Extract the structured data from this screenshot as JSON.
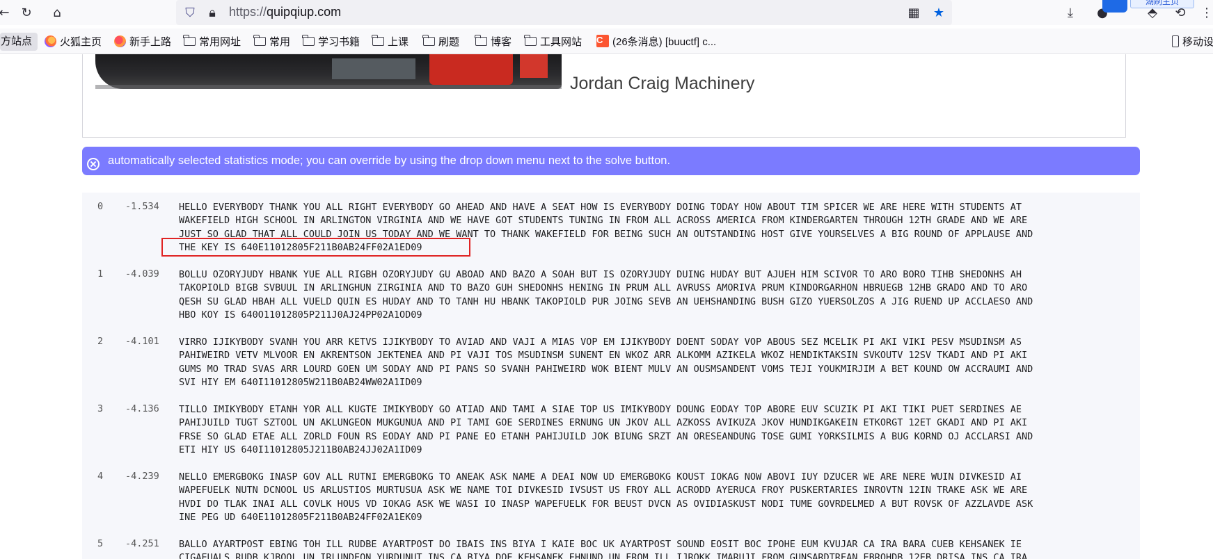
{
  "browser": {
    "url_protocol": "https://",
    "url_host": "quipqiup.com"
  },
  "tooltip": "湖刷主页",
  "bookmarks": {
    "first": "官方站点",
    "items": [
      {
        "label": "火狐主页",
        "icon": "firefox-icon"
      },
      {
        "label": "新手上路",
        "icon": "firefox-icon"
      },
      {
        "label": "常用网址",
        "icon": "folder-icon"
      },
      {
        "label": "常用",
        "icon": "folder-icon"
      },
      {
        "label": "学习书籍",
        "icon": "folder-icon"
      },
      {
        "label": "上课",
        "icon": "folder-icon"
      },
      {
        "label": "刷题",
        "icon": "folder-icon"
      },
      {
        "label": "博客",
        "icon": "folder-icon"
      },
      {
        "label": "工具网站",
        "icon": "folder-icon"
      },
      {
        "label": "(26条消息) [buuctf] c...",
        "icon": "csdn-icon"
      }
    ],
    "mobile": "移动设"
  },
  "hero": {
    "title": "Jordan Craig Machinery"
  },
  "alert": {
    "text": "automatically selected statistics mode; you can override by using the drop down menu next to the solve button."
  },
  "results": [
    {
      "index": "0",
      "score": "-1.534",
      "lines": [
        "HELLO EVERYBODY THANK YOU ALL RIGHT EVERYBODY GO AHEAD AND HAVE A SEAT HOW IS EVERYBODY DOING TODAY HOW ABOUT TIM SPICER WE ARE HERE WITH STUDENTS AT",
        "WAKEFIELD HIGH SCHOOL IN ARLINGTON VIRGINIA AND WE HAVE GOT STUDENTS TUNING IN FROM ALL ACROSS AMERICA FROM KINDERGARTEN THROUGH 12TH GRADE AND WE ARE",
        "JUST SO GLAD THAT ALL COULD JOIN US TODAY AND WE WANT TO THANK WAKEFIELD FOR BEING SUCH AN OUTSTANDING HOST GIVE YOURSELVES A BIG ROUND OF APPLAUSE AND",
        "THE KEY IS 640E11012805F211B0AB24FF02A1ED09"
      ]
    },
    {
      "index": "1",
      "score": "-4.039",
      "lines": [
        "BOLLU OZORYJUDY HBANK YUE ALL RIGBH OZORYJUDY GU ABOAD AND BAZO A SOAH BUT IS OZORYJUDY DUING HUDAY BUT AJUEH HIM SCIVOR TO ARO BORO TIHB SHEDONHS AH",
        "TAKOPIOLD BIGB SVBUUL IN ARLINGHUN ZIRGINIA AND TO BAZO GUH SHEDONHS HENING IN PRUM ALL AVRUSS AMORIVA PRUM KINDORGARHON HBRUEGB 12HB GRADO AND TO ARO",
        "QESH SU GLAD HBAH ALL VUELD QUIN ES HUDAY AND TO TANH HU HBANK TAKOPIOLD PUR JOING SEVB AN UEHSHANDING BUSH GIZO YUERSOLZOS A JIG RUEND UP ACCLAESO AND",
        "HBO KOY IS 640O11012805P211J0AJ24PP02A1OD09"
      ]
    },
    {
      "index": "2",
      "score": "-4.101",
      "lines": [
        "VIRRO IJIKYBODY SVANH YOU ARR KETVS IJIKYBODY TO AVIAD AND VAJI A MIAS VOP EM IJIKYBODY DOENT SODAY VOP ABOUS SEZ MCELIK PI AKI VIKI PESV MSUDINSM AS",
        "PAHIWEIRD VETV MLVOOR EN AKRENTSON JEKTENEA AND PI VAJI TOS MSUDINSM SUNENT EN WKOZ ARR ALKOMM AZIKELA WKOZ HENDIKTAKSIN SVKOUTV 12SV TKADI AND PI AKI",
        "GUMS MO TRAD SVAS ARR LOURD GOEN UM SODAY AND PI PANS SO SVANH PAHIWEIRD WOK BIENT MULV AN OUSMSANDENT VOMS TEJI YOUKMIRJIM A BET KOUND OW ACCRAUMI AND",
        "SVI HIY EM 640I11012805W211B0AB24WW02A1ID09"
      ]
    },
    {
      "index": "3",
      "score": "-4.136",
      "lines": [
        "TILLO IMIKYBODY ETANH YOR ALL KUGTE IMIKYBODY GO ATIAD AND TAMI A SIAE TOP US IMIKYBODY DOUNG EODAY TOP ABORE EUV SCUZIK PI AKI TIKI PUET SERDINES AE",
        "PAHIJUILD TUGT SZTOOL UN AKLUNGEON MUKGUNUA AND PI TAMI GOE SERDINES ERNUNG UN JKOV ALL AZKOSS AVIKUZA JKOV HUNDIKGAKEIN ETKORGT 12ET GKADI AND PI AKI",
        "FRSE SO GLAD ETAE ALL ZORLD FOUN RS EODAY AND PI PANE EO ETANH PAHIJUILD JOK BIUNG SRZT AN ORESEANDUNG TOSE GUMI YORKSILMIS A BUG KORND OJ ACCLARSI AND",
        "ETI HIY US 640I11012805J211B0AB24JJ02A1ID09"
      ]
    },
    {
      "index": "4",
      "score": "-4.239",
      "lines": [
        "NELLO EMERGBOKG INASP GOV ALL RUTNI EMERGBOKG TO ANEAK ASK NAME A DEAI NOW UD EMERGBOKG KOUST IOKAG NOW ABOVI IUY DZUCER WE ARE NERE WUIN DIVKESID AI",
        "WAPEFUELK NUTN DCNOOL US ARLUSTIOS MURTUSUA ASK WE NAME TOI DIVKESID IVSUST US FROY ALL ACRODD AYERUCA FROY PUSKERTARIES INROVTN 12IN TRAKE ASK WE ARE",
        "HVDI DO TLAK INAI ALL COVLK HOUS VD IOKAG ASK WE WASI IO INASP WAPEFUELK FOR BEUST DVCN AS OVIDIASKUST NODI TUME GOVRDELMED A BUT ROVSK OF AZZLAVDE ASK",
        "INE PEG UD 640E11012805F211B0AB24FF02A1EK09"
      ]
    },
    {
      "index": "5",
      "score": "-4.251",
      "lines": [
        "BALLO AYARTPOST EBING TOH ILL RUDBE AYARTPOST DO IBAIS INS BIYA I KAIE BOC UK AYARTPOST SOUND EOSIT BOC IPOHE EUM KVUJAR CA IRA BARA CUEB KEHSANEK IE",
        "CIGAEUALS RUDB KJBOOL UN IRLUNDEON YURDUNUT INS CA BIYA DOE KEHSANEK EHNUND UN FROM ILL IJROKK IMARUJI FROM GUNSARDTREAN EBROHDB 12EB DRISA INS CA IRA"
      ]
    }
  ]
}
